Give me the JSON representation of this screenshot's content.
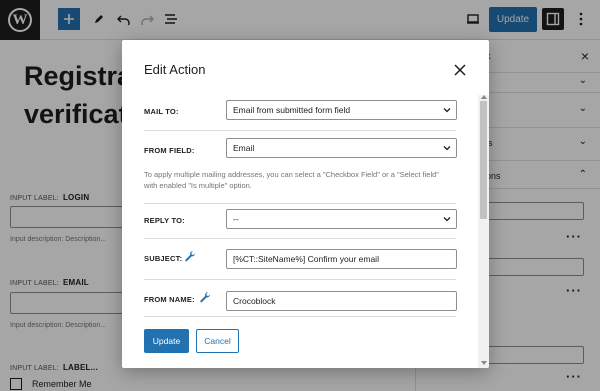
{
  "topbar": {
    "wp_logo_letter": "W",
    "update_label": "Update",
    "icons": [
      "wordpress-logo",
      "plus-icon",
      "pencil-icon",
      "undo-icon",
      "redo-icon",
      "list-view-icon",
      "desktop-preview-icon",
      "settings-icon",
      "more-vertical-icon"
    ]
  },
  "canvas": {
    "heading_line1": "Registrat",
    "heading_line2": "verificati",
    "input_label_prefix": "INPUT LABEL:",
    "fields": [
      {
        "label": "LOGIN",
        "desc": "Input description:  Description..."
      },
      {
        "label": "EMAIL",
        "desc": "Input description:  Description..."
      },
      {
        "label": "LABEL..."
      }
    ],
    "remember_label": "Remember Me"
  },
  "sidebar": {
    "close_glyph": "×",
    "partial_k": "k",
    "partial_s": "s",
    "partial_ons": "ons"
  },
  "modal": {
    "title": "Edit Action",
    "fields": {
      "mail_to": {
        "label": "MAIL TO:",
        "value": "Email from submitted form field"
      },
      "from_field": {
        "label": "FROM FIELD:",
        "value": "Email"
      },
      "help_text": "To apply multiple mailing addresses, you can select a \"Checkbox Field\" or a \"Select field\" with enabled \"Is multiple\" option.",
      "reply_to": {
        "label": "REPLY TO:",
        "value": "--"
      },
      "subject": {
        "label": "SUBJECT:",
        "value": "[%CT::SiteName%] Confirm your email"
      },
      "from_name": {
        "label": "FROM NAME:",
        "value": "Crocoblock"
      }
    },
    "update_label": "Update",
    "cancel_label": "Cancel"
  },
  "colors": {
    "primary": "#2271b1",
    "dark": "#1e1e1e",
    "overlay": "rgba(0,0,0,0.35)"
  }
}
